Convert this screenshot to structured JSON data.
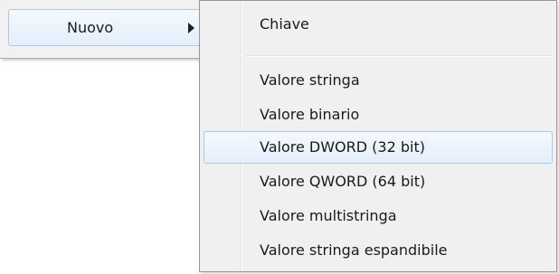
{
  "parent_menu": {
    "item_label": "Nuovo",
    "arrow_icon": "chevron-right-icon"
  },
  "submenu": {
    "key_item": "Chiave",
    "value_items": [
      "Valore stringa",
      "Valore binario",
      "Valore DWORD (32 bit)",
      "Valore QWORD (64 bit)",
      "Valore multistringa",
      "Valore stringa espandibile"
    ],
    "highlighted_item": "Valore DWORD (32 bit)"
  },
  "colors": {
    "highlight_border": "#a8c9ec",
    "menu_background": "#f0f0f0",
    "text": "#1a1a1a"
  }
}
